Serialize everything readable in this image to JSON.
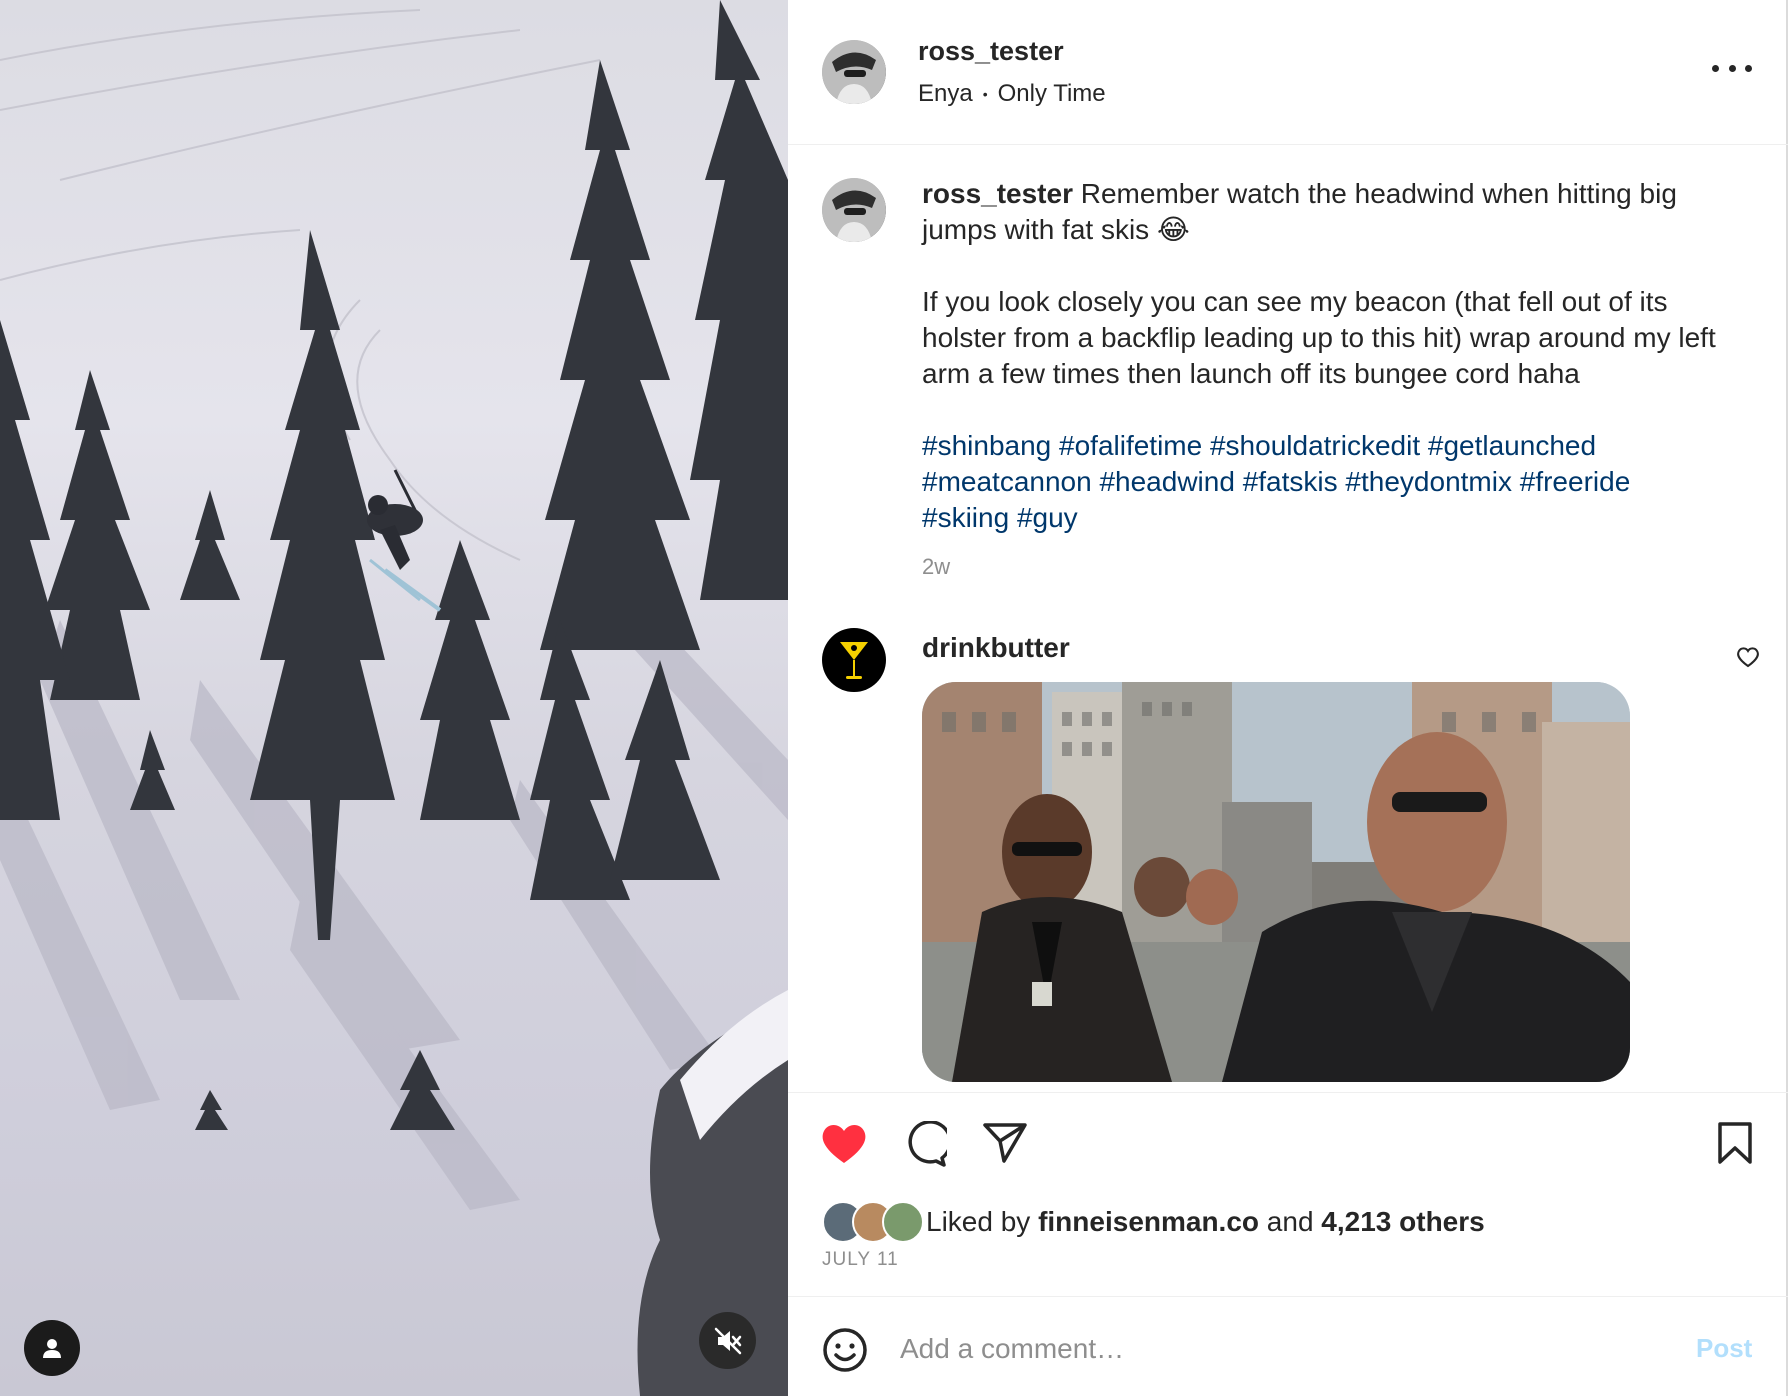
{
  "post": {
    "username": "ross_tester",
    "audio_artist": "Enya",
    "audio_separator": "•",
    "audio_track": "Only Time",
    "more_icon": "more-horizontal-icon"
  },
  "caption": {
    "username": "ross_tester",
    "line1": "Remember watch the headwind when hitting big jumps with fat skis",
    "emoji": "😂",
    "paragraph2": "If you look closely you can see my beacon (that fell out of its holster from a backflip leading up to this hit) wrap around my left arm a few times then launch off its bungee cord haha",
    "hashtags": [
      "#shinbang",
      "#ofalifetime",
      "#shouldatrickedit",
      "#getlaunched",
      "#meatcannon",
      "#headwind",
      "#fatskis",
      "#theydontmix",
      "#freeride",
      "#skiing",
      "#guy"
    ],
    "time": "2w"
  },
  "comment": {
    "username": "drinkbutter"
  },
  "actions": {
    "liked": true,
    "like_color": "#ff3040",
    "liked_by_prefix": "Liked by",
    "liked_by_user": "finneisenman.co",
    "liked_by_and": "and",
    "liked_by_others": "4,213 others",
    "date": "JULY 11"
  },
  "add_comment": {
    "placeholder": "Add a comment…",
    "post_label": "Post",
    "post_color": "#b2dffc"
  },
  "hashtag_color": "#00376b"
}
